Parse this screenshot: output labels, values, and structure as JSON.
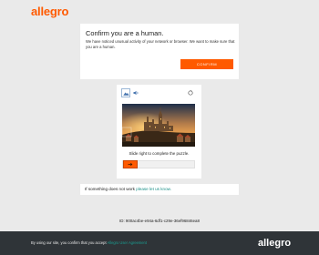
{
  "brand": {
    "logo_text": "allegro",
    "accent_color": "#ff5a00"
  },
  "confirm": {
    "title": "Confirm you are a human.",
    "message": "We have noticed unusual activity of your network or browser. We want to make sure that you are a human.",
    "button_label": "CONFIRM"
  },
  "captcha": {
    "tabs": [
      {
        "icon": "image-puzzle-icon",
        "selected": true
      },
      {
        "icon": "audio-icon",
        "selected": false
      }
    ],
    "refresh_icon": "refresh-icon",
    "image_subject": "old town castle at sunset",
    "hint": "Slide right to complete the puzzle.",
    "slider_handle_icon": "arrow-right-icon",
    "slider_progress": 0
  },
  "help": {
    "prefix": "If something does not work ",
    "link_text": "please let us know."
  },
  "request_id": "ID: 900ac4be-e94a-6df1-c29e-36ef96846ea8",
  "footer": {
    "consent_prefix": "By using our site, you confirm that you accept ",
    "consent_link": "Allegro User Agreement",
    "logo_text": "allegro"
  }
}
